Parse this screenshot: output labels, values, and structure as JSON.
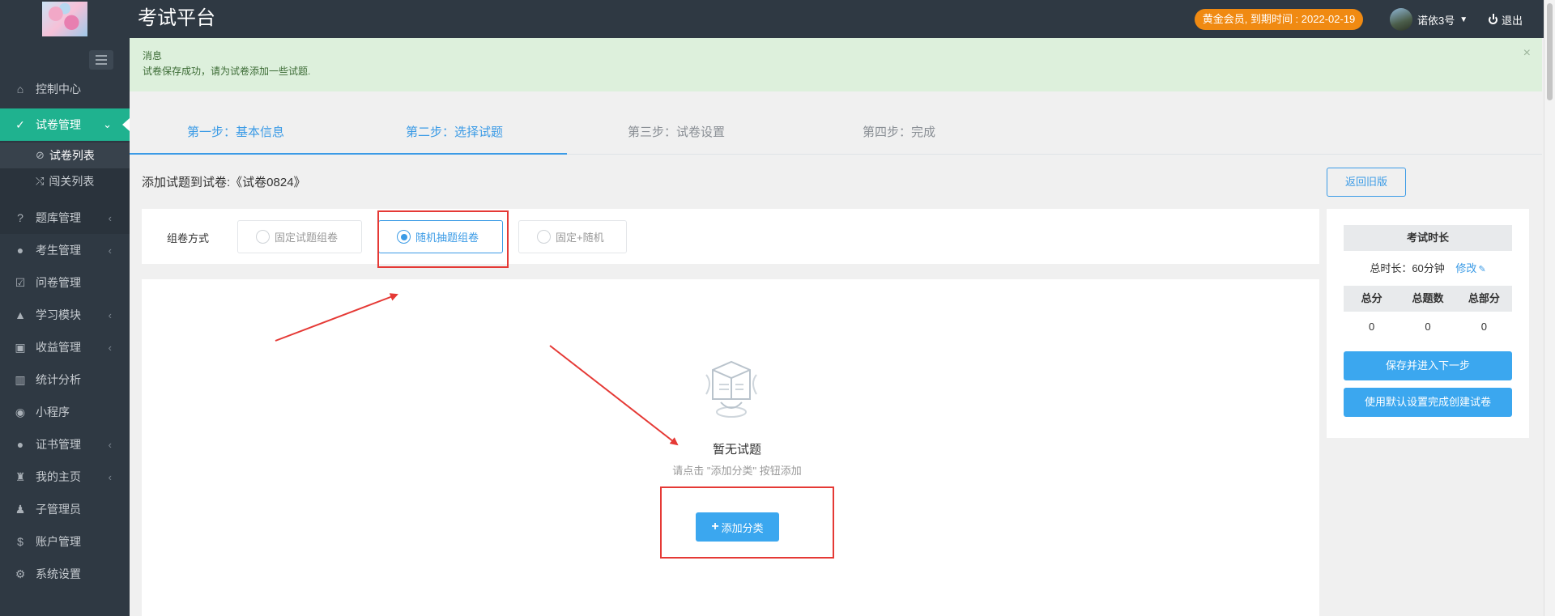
{
  "header": {
    "app_title": "考试平台",
    "vip_badge": "黄金会员, 到期时间 : 2022-02-19",
    "user_name": "诺依3号",
    "logout_label": "退出"
  },
  "sidebar": {
    "items": [
      {
        "label": "控制中心",
        "icon": "home-icon"
      },
      {
        "label": "试卷管理",
        "icon": "check-circle-icon"
      },
      {
        "label": "题库管理",
        "icon": "question-circle-icon"
      },
      {
        "label": "考生管理",
        "icon": "user-icon"
      },
      {
        "label": "问卷管理",
        "icon": "checkbox-icon"
      },
      {
        "label": "学习模块",
        "icon": "graduation-cap-icon"
      },
      {
        "label": "收益管理",
        "icon": "money-icon"
      },
      {
        "label": "统计分析",
        "icon": "bar-chart-icon"
      },
      {
        "label": "小程序",
        "icon": "wechat-icon"
      },
      {
        "label": "证书管理",
        "icon": "certificate-icon"
      },
      {
        "label": "我的主页",
        "icon": "home-page-icon"
      },
      {
        "label": "子管理员",
        "icon": "sub-admin-icon"
      },
      {
        "label": "账户管理",
        "icon": "dollar-icon"
      },
      {
        "label": "系统设置",
        "icon": "gear-icon"
      }
    ],
    "sub_items": [
      {
        "label": "试卷列表",
        "icon": "check-circle-icon"
      },
      {
        "label": "闯关列表",
        "icon": "shuffle-icon"
      }
    ]
  },
  "alert": {
    "title": "消息",
    "message": "试卷保存成功，请为试卷添加一些试题."
  },
  "steps": [
    {
      "label": "第一步：基本信息"
    },
    {
      "label": "第二步：选择试题"
    },
    {
      "label": "第三步：试卷设置"
    },
    {
      "label": "第四步：完成"
    }
  ],
  "paper": {
    "title": "添加试题到试卷:《试卷0824》",
    "back_button": "返回旧版"
  },
  "compose": {
    "label": "组卷方式",
    "options": [
      "固定试题组卷",
      "随机抽题组卷",
      "固定+随机"
    ],
    "selected": "随机抽题组卷"
  },
  "empty": {
    "title": "暂无试题",
    "hint": "请点击 \"添加分类\" 按钮添加",
    "add_button": "添加分类"
  },
  "exam_panel": {
    "header": "考试时长",
    "duration_text": "总时长：60分钟",
    "edit_label": "修改",
    "stats_headers": [
      "总分",
      "总题数",
      "总部分"
    ],
    "stats_values": [
      "0",
      "0",
      "0"
    ],
    "save_next_button": "保存并进入下一步",
    "default_create_button": "使用默认设置完成创建试卷"
  },
  "colors": {
    "sidebar_bg": "#2f3943",
    "active_green": "#1fb28f",
    "primary_blue": "#3b9be6",
    "vip_orange": "#f08a12",
    "annotation_red": "#e53935"
  }
}
